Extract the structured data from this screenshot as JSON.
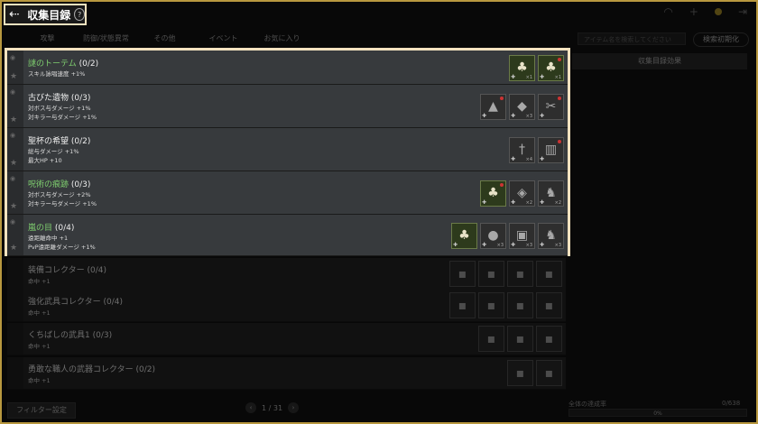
{
  "title": {
    "back_icon": "back-arrow-icon",
    "label": "収集目録",
    "help": "?"
  },
  "tabs": [
    "攻撃",
    "防御/状態異常",
    "その他",
    "イベント",
    "お気に入り"
  ],
  "search_placeholder": "アイテム名を検索してください",
  "reset_label": "検索初期化",
  "effect_header": "収集目録効果",
  "rows_highlight": [
    {
      "name": "謎のトーテム",
      "count": "(0/2)",
      "green": true,
      "stats": [
        "スキル詠唱速度 +1%"
      ],
      "items": [
        {
          "g": "♣",
          "has": true,
          "cnt": "×1",
          "dot": false
        },
        {
          "g": "♣",
          "has": true,
          "cnt": "×1",
          "dot": true
        }
      ]
    },
    {
      "name": "古びた遺物",
      "count": "(0/3)",
      "green": false,
      "stats": [
        "対ボス与ダメージ +1%",
        "対キラー与ダメージ +1%"
      ],
      "items": [
        {
          "g": "▲",
          "has": false,
          "cnt": "",
          "dot": true
        },
        {
          "g": "◆",
          "has": false,
          "cnt": "×3",
          "dot": false
        },
        {
          "g": "✂",
          "has": false,
          "cnt": "",
          "dot": true
        }
      ]
    },
    {
      "name": "聖杯の希望",
      "count": "(0/2)",
      "green": false,
      "stats": [
        "総与ダメージ +1%",
        "最大HP +10"
      ],
      "items": [
        {
          "g": "†",
          "has": false,
          "cnt": "×4",
          "dot": false
        },
        {
          "g": "▥",
          "has": false,
          "cnt": "",
          "dot": true
        }
      ]
    },
    {
      "name": "呪術の痕跡",
      "count": "(0/3)",
      "green": true,
      "stats": [
        "対ボス与ダメージ +2%",
        "対キラー与ダメージ +1%"
      ],
      "items": [
        {
          "g": "♣",
          "has": true,
          "cnt": "",
          "dot": true
        },
        {
          "g": "◈",
          "has": false,
          "cnt": "×2",
          "dot": false
        },
        {
          "g": "♞",
          "has": false,
          "cnt": "×2",
          "dot": false
        }
      ]
    },
    {
      "name": "嵐の目",
      "count": "(0/4)",
      "green": true,
      "stats": [
        "遠距離命中 +1",
        "PvP遠距離ダメージ +1%"
      ],
      "items": [
        {
          "g": "♣",
          "has": true,
          "cnt": "",
          "dot": false
        },
        {
          "g": "●",
          "has": false,
          "cnt": "×3",
          "dot": false
        },
        {
          "g": "▣",
          "has": false,
          "cnt": "×3",
          "dot": false
        },
        {
          "g": "♞",
          "has": false,
          "cnt": "×3",
          "dot": false
        }
      ]
    }
  ],
  "rows_dim": [
    {
      "name": "装備コレクター (0/4)",
      "stat": "命中 +1",
      "n": 4
    },
    {
      "name": "強化武具コレクター (0/4)",
      "stat": "命中 +1",
      "n": 4
    },
    {
      "name": "くちばしの武具1 (0/3)",
      "stat": "命中 +1",
      "n": 3
    },
    {
      "name": "勇敢な職人の武器コレクター (0/2)",
      "stat": "命中 +1",
      "n": 2
    }
  ],
  "filter_label": "フィルター設定",
  "pager": "1 / 31",
  "progress": {
    "label": "全体の達成率",
    "count": "0/638",
    "percent": "0%",
    "value": 0
  },
  "colors": {
    "accent": "#f3e2bf",
    "frame": "#b8983f",
    "green": "#7fcf6f"
  },
  "top_icons": [
    "wifi-icon",
    "plus-icon",
    "coin-icon",
    "exit-icon"
  ]
}
